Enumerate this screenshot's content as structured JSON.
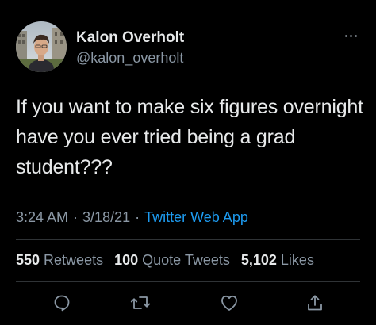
{
  "author": {
    "display_name": "Kalon Overholt",
    "handle": "@kalon_overholt",
    "avatar_icon": "profile-photo"
  },
  "tweet": {
    "text": "If you want to make six figures overnight have you ever tried being a grad student???"
  },
  "meta": {
    "time": "3:24 AM",
    "separator": "·",
    "date": "3/18/21",
    "source": "Twitter Web App"
  },
  "stats": {
    "retweets_count": "550",
    "retweets_label": "Retweets",
    "quotes_count": "100",
    "quotes_label": "Quote Tweets",
    "likes_count": "5,102",
    "likes_label": "Likes"
  },
  "actions": {
    "reply_icon": "reply-icon",
    "retweet_icon": "retweet-icon",
    "like_icon": "heart-icon",
    "share_icon": "share-icon"
  },
  "colors": {
    "background": "#000000",
    "text_primary": "#e7e9ea",
    "text_secondary": "#8b98a5",
    "link": "#1d9bf0",
    "divider": "#2f3336"
  }
}
